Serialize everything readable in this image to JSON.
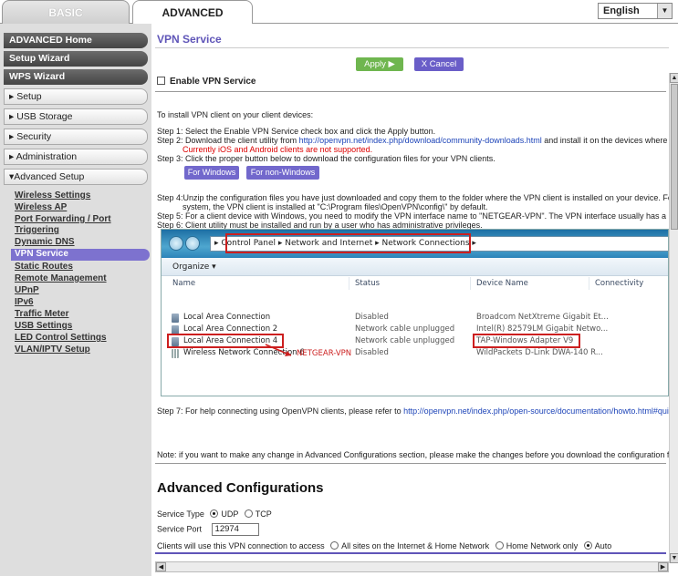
{
  "tabs": {
    "basic": "BASIC",
    "advanced": "ADVANCED"
  },
  "language": {
    "selected": "English"
  },
  "sidebar": {
    "advanced_home": "ADVANCED Home",
    "setup_wizard": "Setup Wizard",
    "wps_wizard": "WPS Wizard",
    "setup": "▸ Setup",
    "usb_storage": "▸ USB Storage",
    "security": "▸ Security",
    "administration": "▸ Administration",
    "advanced_setup": "▾Advanced Setup",
    "links": {
      "wireless_settings": "Wireless Settings",
      "wireless_ap": "Wireless AP",
      "port_forwarding": "Port Forwarding / Port Triggering",
      "dynamic_dns": "Dynamic DNS",
      "vpn_service": "VPN Service",
      "static_routes": "Static Routes",
      "remote_management": "Remote Management",
      "upnp": "UPnP",
      "ipv6": "IPv6",
      "traffic_meter": "Traffic Meter",
      "usb_settings": "USB Settings",
      "led_control": "LED Control Settings",
      "vlan_iptv": "VLAN/IPTV Setup"
    }
  },
  "main": {
    "title": "VPN Service",
    "apply": "Apply ▶",
    "cancel": "X Cancel",
    "enable_label": "Enable VPN Service",
    "intro": "To install VPN client on your client devices:",
    "step1": "Step 1: Select the Enable VPN Service check box and click the Apply button.",
    "step2_a": "Step 2: Download the client utility from",
    "step2_link": "http://openvpn.net/index.php/download/community-downloads.html",
    "step2_b": "and install it on the devices where you want t",
    "step2_warn": "Currently iOS and Android clients are not supported.",
    "step3": "Step 3: Click the proper button below to download the configuration files for your VPN clients.",
    "btn_windows": "For Windows",
    "btn_non_windows": "For non-Windows",
    "step4_a": "Step 4:Unzip the configuration files you have just downloaded and copy them to the folder where the VPN client is installed on your device. For a client d",
    "step4_b": "system, the VPN client is installed at \"C:\\Program files\\OpenVPN\\config\\\" by default.",
    "step5": "Step 5: For a client device with Windows, you need to modify the VPN interface name to \"NETGEAR-VPN\". The VPN interface usually has a Device Nam",
    "step6": "Step 6: Client utility must be installed and run by a user who has administrative privileges.",
    "step7_a": "Step 7: For help connecting using OpenVPN clients, please refer to",
    "step7_link": "http://openvpn.net/index.php/open-source/documentation/howto.html#quick",
    "note": "Note: if you want to make any change in Advanced Configurations section, please make the changes before you download the configuration files in Ste",
    "advanced_title": "Advanced Configurations",
    "service_type_label": "Service Type",
    "udp": "UDP",
    "tcp": "TCP",
    "service_port_label": "Service Port",
    "service_port_value": "12974",
    "access_label": "Clients will use this VPN connection to access",
    "access_all": "All sites on the Internet & Home Network",
    "access_home": "Home Network only",
    "access_auto": "Auto"
  },
  "screenshot": {
    "address": "▸  Control Panel  ▸  Network and Internet  ▸  Network Connections  ▸",
    "organize": "Organize ▾",
    "headers": {
      "name": "Name",
      "status": "Status",
      "device": "Device Name",
      "conn": "Connectivity"
    },
    "rows": [
      {
        "name": "Local Area Connection",
        "status": "Disabled",
        "device": "Broadcom NetXtreme Gigabit Et..."
      },
      {
        "name": "Local Area Connection 2",
        "status": "Network cable unplugged",
        "device": "Intel(R) 82579LM Gigabit Netwo..."
      },
      {
        "name": "Local Area Connection 4",
        "status": "Network cable unplugged",
        "device": "TAP-Windows Adapter V9"
      },
      {
        "name": "Wireless Network Connection 6",
        "status": "Disabled",
        "device": "WildPackets D-Link DWA-140 R..."
      }
    ],
    "annotation": "NETGEAR-VPN"
  }
}
